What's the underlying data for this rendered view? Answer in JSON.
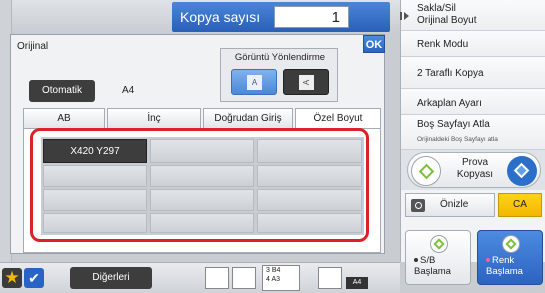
{
  "header": {
    "copy_count_label": "Kopya sayısı",
    "copy_count_value": "1"
  },
  "right_panel": {
    "items": [
      {
        "label": "Sakla/Sil\nOrijinal Boyut"
      },
      {
        "label": "Renk Modu"
      },
      {
        "label": "2 Taraflı Kopya"
      },
      {
        "label": "Arkaplan Ayarı"
      },
      {
        "label": "Boş Sayfayı Atla",
        "sub": "Orijinaldeki Boş Sayfayı atla"
      }
    ],
    "proof_copy": "Prova\nKopyası",
    "preview": "Önizle",
    "ca": "CA",
    "bw_start": "S/B\nBaşlama",
    "color_start": "Renk\nBaşlama"
  },
  "dialog": {
    "title": "Orijinal",
    "ok": "OK",
    "orientation_label": "Görüntü Yönlendirme",
    "orientation_a": "A",
    "orientation_b": "A",
    "auto_button": "Otomatik",
    "size_value": "A4",
    "tabs": [
      {
        "label": "AB",
        "active": false
      },
      {
        "label": "İnç",
        "active": false
      },
      {
        "label": "Doğrudan Giriş",
        "active": false
      },
      {
        "label": "Özel Boyut",
        "active": true
      }
    ],
    "custom_sizes": [
      "X420 Y297",
      "",
      "",
      "",
      "",
      "",
      "",
      "",
      "",
      "",
      "",
      ""
    ]
  },
  "bottom_bar": {
    "others": "Diğerleri",
    "tray_lines": [
      "3  B4",
      "4  A3"
    ],
    "paper_size": "A4"
  },
  "colors": {
    "accent_blue": "#2c63c0",
    "highlight_red": "#d92328",
    "clear_yellow": "#f2b800",
    "start_green": "#7bbf3a"
  }
}
